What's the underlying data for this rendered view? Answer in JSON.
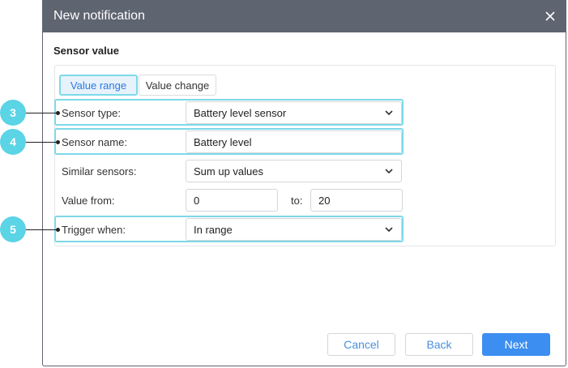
{
  "dialog": {
    "title": "New notification",
    "close_icon": "close-icon"
  },
  "section": {
    "title": "Sensor value"
  },
  "tabs": [
    {
      "label": "Value range",
      "active": true
    },
    {
      "label": "Value change",
      "active": false
    }
  ],
  "form": {
    "sensor_type": {
      "label": "Sensor type:",
      "value": "Battery level sensor"
    },
    "sensor_name": {
      "label": "Sensor name:",
      "value": "Battery level"
    },
    "similar_sensors": {
      "label": "Similar sensors:",
      "value": "Sum up values"
    },
    "value_from": {
      "label": "Value from:",
      "value": "0"
    },
    "value_to": {
      "label": "to:",
      "value": "20"
    },
    "trigger_when": {
      "label": "Trigger when:",
      "value": "In range"
    }
  },
  "callouts": [
    {
      "number": "3"
    },
    {
      "number": "4"
    },
    {
      "number": "5"
    }
  ],
  "buttons": {
    "cancel": "Cancel",
    "back": "Back",
    "next": "Next"
  },
  "colors": {
    "titlebar": "#5e6470",
    "accent": "#3c8ef0",
    "highlight": "#7dd9e8",
    "callout_badge": "#5bd4e6"
  }
}
